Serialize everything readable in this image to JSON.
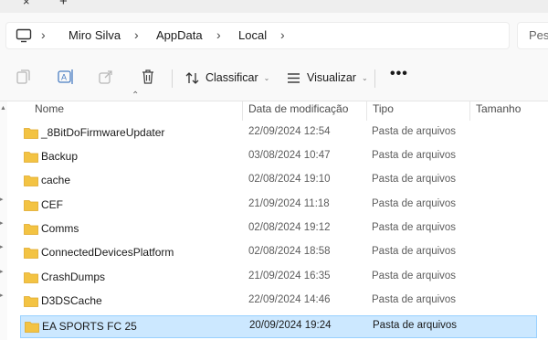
{
  "tabs": {
    "close_glyph": "×",
    "new_glyph": "+"
  },
  "address": {
    "icon": "computer-icon",
    "crumbs": [
      "Miro Silva",
      "AppData",
      "Local"
    ],
    "search_placeholder": "Pesq"
  },
  "toolbar": {
    "sort_label": "Classificar",
    "view_label": "Visualizar",
    "more_label": "•••"
  },
  "columns": {
    "name": "Nome",
    "date": "Data de modificação",
    "type": "Tipo",
    "size": "Tamanho"
  },
  "files": [
    {
      "name": "_8BitDoFirmwareUpdater",
      "date": "22/09/2024 12:54",
      "type": "Pasta de arquivos",
      "selected": false
    },
    {
      "name": "Backup",
      "date": "03/08/2024 10:47",
      "type": "Pasta de arquivos",
      "selected": false
    },
    {
      "name": "cache",
      "date": "02/08/2024 19:10",
      "type": "Pasta de arquivos",
      "selected": false
    },
    {
      "name": "CEF",
      "date": "21/09/2024 11:18",
      "type": "Pasta de arquivos",
      "selected": false
    },
    {
      "name": "Comms",
      "date": "02/08/2024 19:12",
      "type": "Pasta de arquivos",
      "selected": false
    },
    {
      "name": "ConnectedDevicesPlatform",
      "date": "02/08/2024 18:58",
      "type": "Pasta de arquivos",
      "selected": false
    },
    {
      "name": "CrashDumps",
      "date": "21/09/2024 16:35",
      "type": "Pasta de arquivos",
      "selected": false
    },
    {
      "name": "D3DSCache",
      "date": "22/09/2024 14:46",
      "type": "Pasta de arquivos",
      "selected": false
    },
    {
      "name": "EA SPORTS FC 25",
      "date": "20/09/2024 19:24",
      "type": "Pasta de arquivos",
      "selected": true
    }
  ],
  "colors": {
    "folder": "#f3c343",
    "folder_dark": "#e0a92a",
    "selection": "#cce8ff",
    "selection_border": "#99d1ff"
  }
}
